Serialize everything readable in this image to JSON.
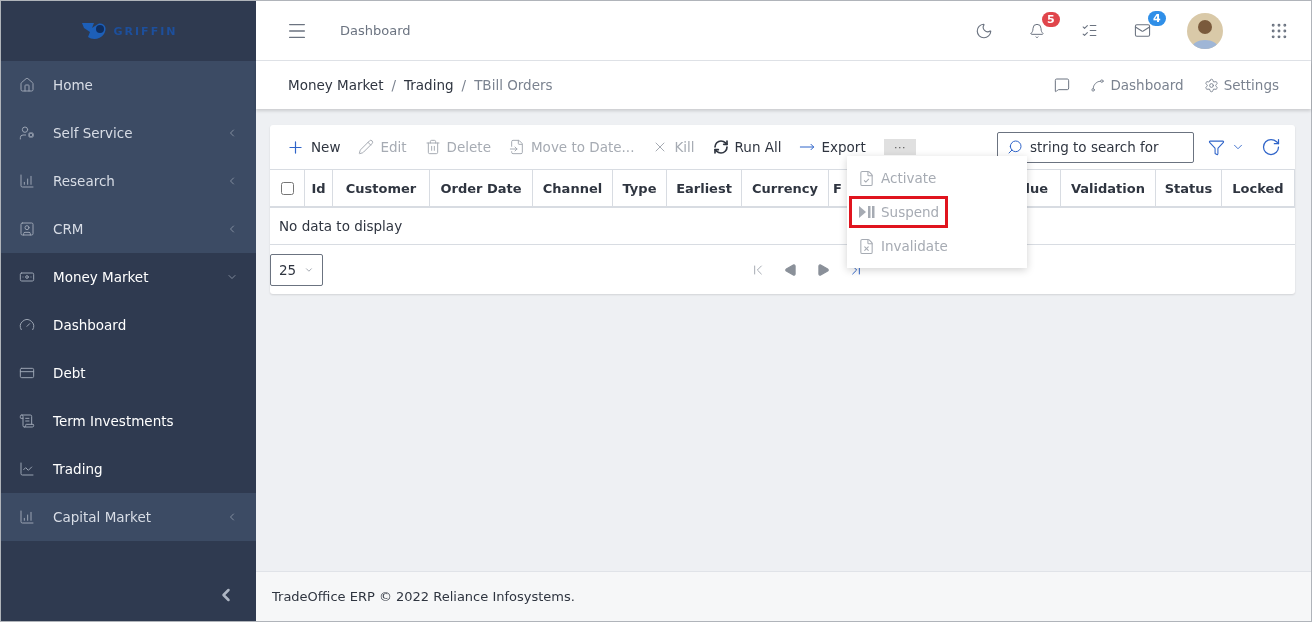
{
  "sidebar": {
    "logo": "GRIFFIN",
    "items": [
      {
        "label": "Home",
        "submenu": false,
        "expanded": false
      },
      {
        "label": "Self Service",
        "submenu": true,
        "expanded": false
      },
      {
        "label": "Research",
        "submenu": true,
        "expanded": false
      },
      {
        "label": "CRM",
        "submenu": true,
        "expanded": false
      },
      {
        "label": "Money Market",
        "submenu": true,
        "expanded": true,
        "children": [
          {
            "label": "Dashboard"
          },
          {
            "label": "Debt"
          },
          {
            "label": "Term Investments"
          },
          {
            "label": "Trading"
          }
        ]
      },
      {
        "label": "Capital Market",
        "submenu": true,
        "expanded": false
      }
    ]
  },
  "header": {
    "title": "Dashboard",
    "notifications": "5",
    "messages": "4"
  },
  "breadcrumb": {
    "separator": "/",
    "items": [
      "Money Market",
      "Trading",
      "TBill Orders"
    ],
    "links": [
      "Dashboard",
      "Settings"
    ]
  },
  "toolbar": {
    "items": [
      {
        "label": "New",
        "disabled": false
      },
      {
        "label": "Edit",
        "disabled": true
      },
      {
        "label": "Delete",
        "disabled": true
      },
      {
        "label": "Move to Date...",
        "disabled": true
      },
      {
        "label": "Kill",
        "disabled": true
      },
      {
        "label": "Run All",
        "disabled": false
      },
      {
        "label": "Export",
        "disabled": false
      }
    ],
    "more": "···",
    "search": {
      "placeholder": "string to search for"
    }
  },
  "table": {
    "checked": false,
    "columns": [
      "Id",
      "Customer",
      "Order Date",
      "Channel",
      "Type",
      "Earliest",
      "Currency",
      "F",
      "lue",
      "Validation",
      "Status",
      "Locked"
    ],
    "empty": "No data to display"
  },
  "pager": {
    "page_size": "25"
  },
  "menu": {
    "items": [
      {
        "label": "Activate",
        "disabled": true,
        "highlighted": false
      },
      {
        "label": "Suspend",
        "disabled": true,
        "highlighted": true
      },
      {
        "label": "Invalidate",
        "disabled": true,
        "highlighted": false
      }
    ]
  },
  "footer": "TradeOffice ERP © 2022 Reliance Infosystems."
}
